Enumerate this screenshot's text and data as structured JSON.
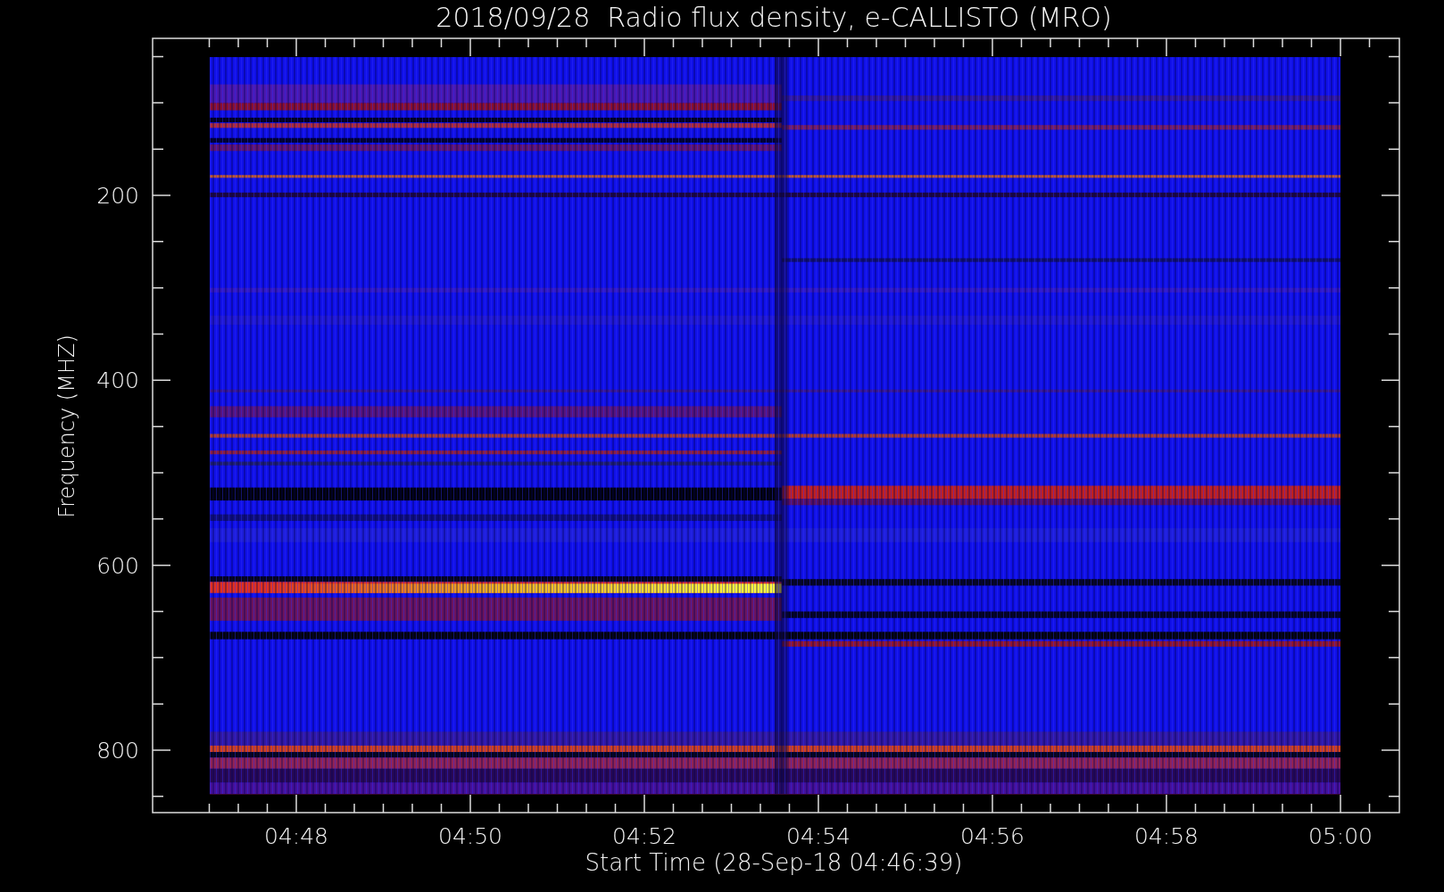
{
  "title": "2018/09/28  Radio flux density, e-CALLISTO (MRO)",
  "y_axis": {
    "title": "Frequency (MHZ)",
    "ticks": [
      "200",
      "400",
      "600",
      "800"
    ]
  },
  "x_axis": {
    "title": "Start Time (28-Sep-18 04:46:39)",
    "ticks": [
      "04:48",
      "04:50",
      "04:52",
      "04:54",
      "04:56",
      "04:58",
      "05:00"
    ]
  }
}
